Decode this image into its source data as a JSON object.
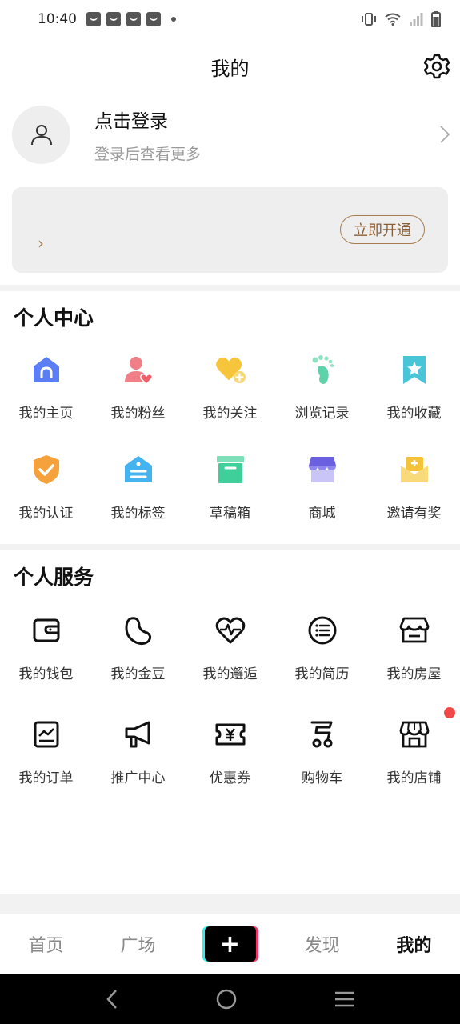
{
  "status_bar": {
    "time": "10:40",
    "icons": [
      "bag-icon",
      "bag-icon",
      "bag-icon",
      "bag-icon",
      "dot-icon",
      "vibrate-icon",
      "wifi-icon",
      "signal-icon",
      "battery-icon"
    ]
  },
  "header": {
    "title": "我的",
    "settings_icon": "gear-icon"
  },
  "profile": {
    "title": "点击登录",
    "subtitle": "登录后查看更多",
    "avatar_icon": "user-icon"
  },
  "vip_card": {
    "arrow": "›",
    "button_label": "立即开通"
  },
  "personal_center": {
    "title": "个人中心",
    "items": [
      {
        "label": "我的主页",
        "icon": "home-icon",
        "color": "#5b7df5"
      },
      {
        "label": "我的粉丝",
        "icon": "fans-icon",
        "color": "#f07f87"
      },
      {
        "label": "我的关注",
        "icon": "heart-plus-icon",
        "color": "#f7c53b"
      },
      {
        "label": "浏览记录",
        "icon": "footprint-icon",
        "color": "#5fd3a8"
      },
      {
        "label": "我的收藏",
        "icon": "bookmark-star-icon",
        "color": "#48c6d8"
      },
      {
        "label": "我的认证",
        "icon": "shield-check-icon",
        "color": "#f5a23d"
      },
      {
        "label": "我的标签",
        "icon": "tag-icon",
        "color": "#45b3ef"
      },
      {
        "label": "草稿箱",
        "icon": "box-icon",
        "color": "#3fcf9a"
      },
      {
        "label": "商城",
        "icon": "store-icon",
        "color": "#8f86f0"
      },
      {
        "label": "邀请有奖",
        "icon": "envelope-icon",
        "color": "#f5cf4a"
      }
    ]
  },
  "personal_service": {
    "title": "个人服务",
    "items": [
      {
        "label": "我的钱包",
        "icon": "wallet-icon"
      },
      {
        "label": "我的金豆",
        "icon": "bean-icon"
      },
      {
        "label": "我的邂逅",
        "icon": "heartbeat-icon"
      },
      {
        "label": "我的简历",
        "icon": "list-icon"
      },
      {
        "label": "我的房屋",
        "icon": "house-icon"
      },
      {
        "label": "我的订单",
        "icon": "order-chart-icon"
      },
      {
        "label": "推广中心",
        "icon": "megaphone-icon"
      },
      {
        "label": "优惠券",
        "icon": "coupon-icon"
      },
      {
        "label": "购物车",
        "icon": "cart-icon"
      },
      {
        "label": "我的店铺",
        "icon": "shop-icon",
        "badge": true
      }
    ]
  },
  "bottom_nav": {
    "items": [
      {
        "label": "首页",
        "active": false
      },
      {
        "label": "广场",
        "active": false
      },
      {
        "label": "+",
        "active": false
      },
      {
        "label": "发现",
        "active": false
      },
      {
        "label": "我的",
        "active": true
      }
    ]
  },
  "system_nav": [
    "back-icon",
    "home-circle-icon",
    "recents-icon"
  ]
}
